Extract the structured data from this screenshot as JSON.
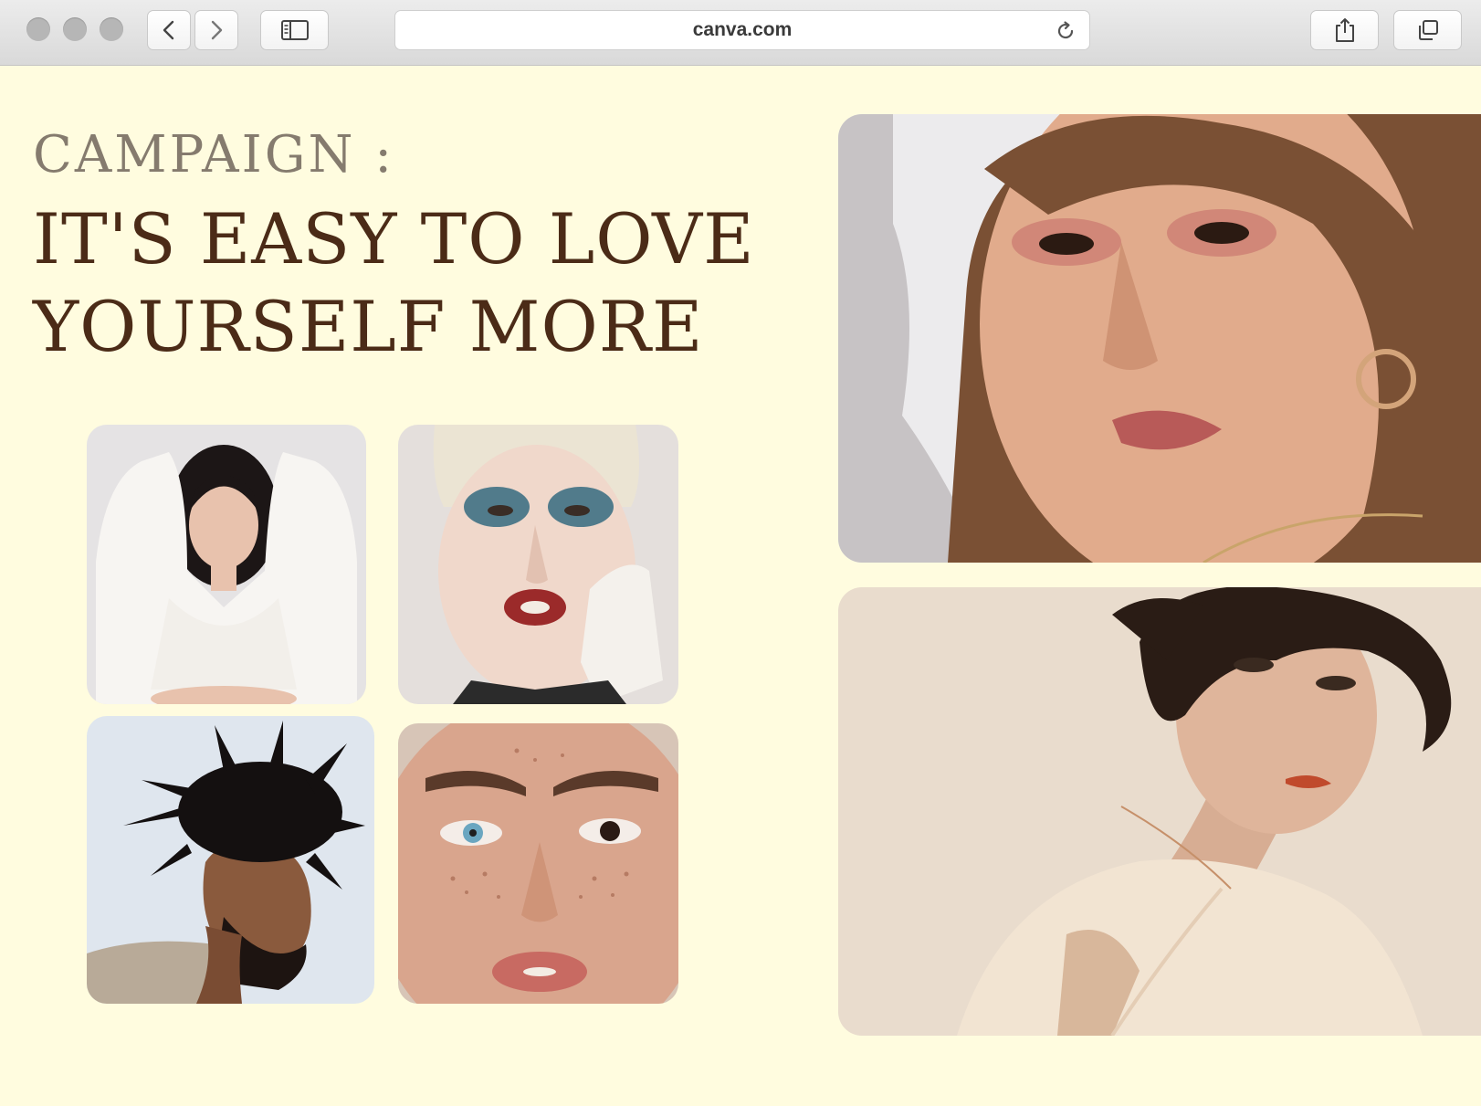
{
  "browser": {
    "url": "canva.com"
  },
  "page": {
    "kicker": "CAMPAIGN :",
    "headline_line1": "IT'S EASY TO LOVE",
    "headline_line2": "YOURSELF MORE"
  },
  "colors": {
    "background": "#fffcdf",
    "kicker": "#857b6e",
    "headline": "#4b2b17"
  },
  "icons": [
    "back-icon",
    "forward-icon",
    "sidebar-icon",
    "reload-icon",
    "share-icon",
    "tabs-icon"
  ]
}
